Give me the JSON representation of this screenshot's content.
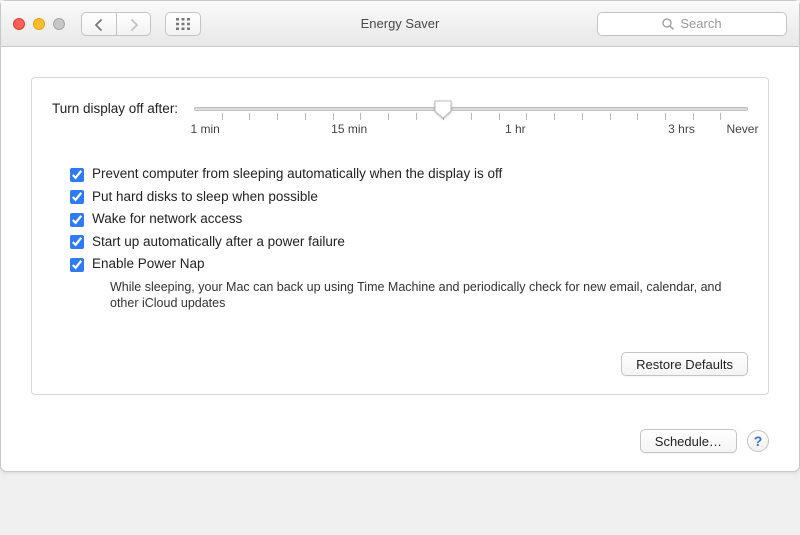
{
  "header": {
    "title": "Energy Saver",
    "search_placeholder": "Search"
  },
  "slider": {
    "label": "Turn display off after:",
    "ticks": {
      "t1": "1 min",
      "t2": "15 min",
      "t3": "1 hr",
      "t4": "3 hrs",
      "t5": "Never"
    },
    "value_percent": 45
  },
  "checks": {
    "prevent_sleep": {
      "label": "Prevent computer from sleeping automatically when the display is off",
      "checked": true
    },
    "hard_disks": {
      "label": "Put hard disks to sleep when possible",
      "checked": true
    },
    "wake_network": {
      "label": "Wake for network access",
      "checked": true
    },
    "power_failure": {
      "label": "Start up automatically after a power failure",
      "checked": true
    },
    "power_nap": {
      "label": "Enable Power Nap",
      "checked": true,
      "desc": "While sleeping, your Mac can back up using Time Machine and periodically check for new email, calendar, and other iCloud updates"
    }
  },
  "buttons": {
    "restore": "Restore Defaults",
    "schedule": "Schedule…"
  }
}
